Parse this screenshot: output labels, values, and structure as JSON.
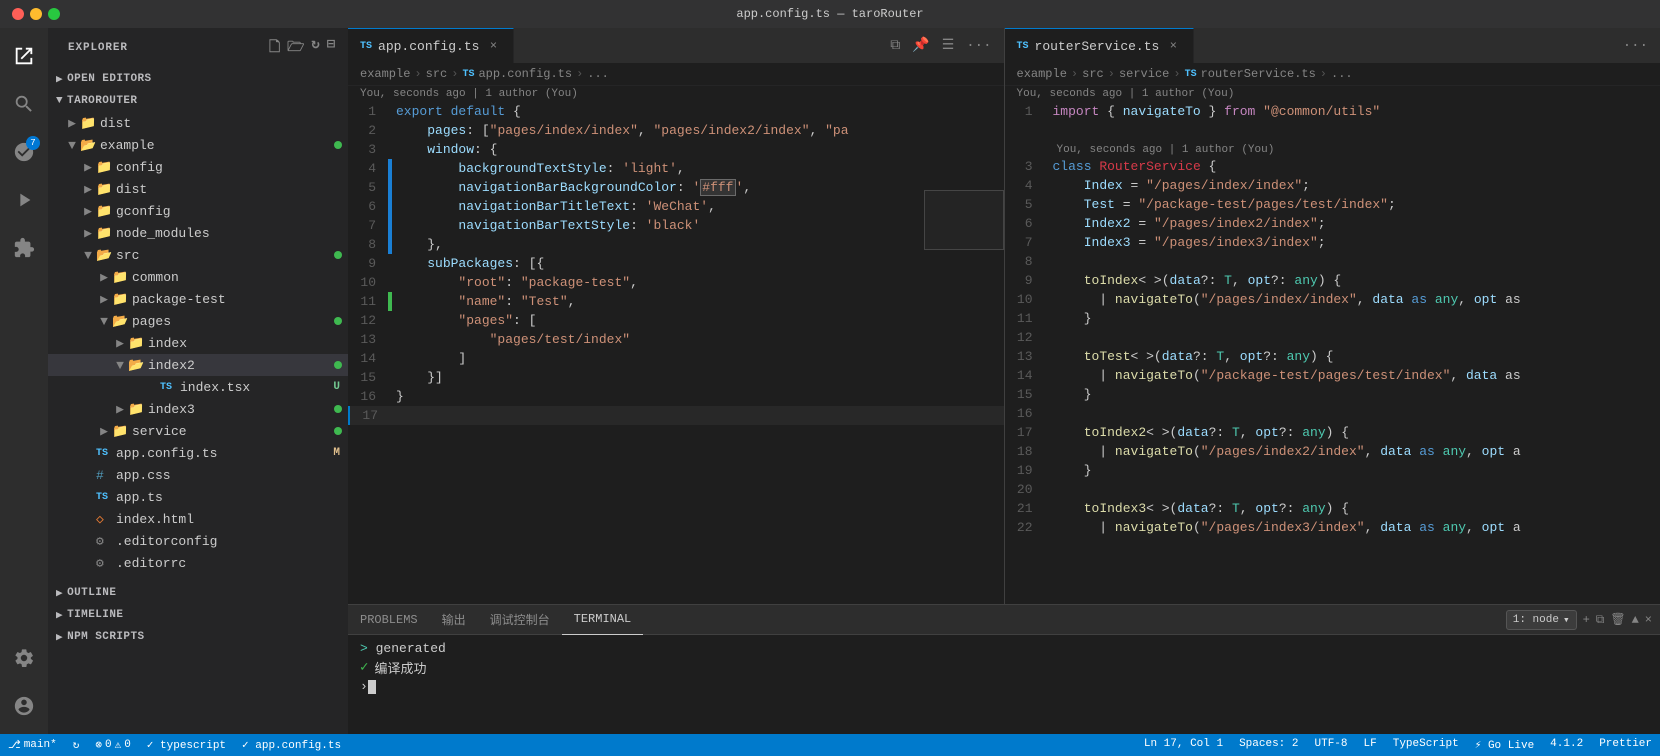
{
  "titlebar": {
    "title": "app.config.ts — taroRouter"
  },
  "sidebar": {
    "title": "EXPLORER",
    "header_actions": [
      "new-file",
      "new-folder",
      "refresh",
      "collapse"
    ],
    "open_editors_label": "OPEN EDITORS",
    "project_label": "TAROROUTER",
    "tree": [
      {
        "id": "dist",
        "label": "dist",
        "type": "folder",
        "depth": 1,
        "expanded": false
      },
      {
        "id": "example",
        "label": "example",
        "type": "folder",
        "depth": 1,
        "expanded": true,
        "dot": "green"
      },
      {
        "id": "config",
        "label": "config",
        "type": "folder",
        "depth": 2,
        "expanded": false
      },
      {
        "id": "dist2",
        "label": "dist",
        "type": "folder",
        "depth": 2,
        "expanded": false
      },
      {
        "id": "gconfig",
        "label": "gconfig",
        "type": "folder",
        "depth": 2,
        "expanded": false
      },
      {
        "id": "node_modules",
        "label": "node_modules",
        "type": "folder",
        "depth": 2,
        "expanded": false
      },
      {
        "id": "src",
        "label": "src",
        "type": "folder",
        "depth": 2,
        "expanded": true,
        "dot": "green"
      },
      {
        "id": "common",
        "label": "common",
        "type": "folder",
        "depth": 3,
        "expanded": false
      },
      {
        "id": "package-test",
        "label": "package-test",
        "type": "folder",
        "depth": 3,
        "expanded": false
      },
      {
        "id": "pages",
        "label": "pages",
        "type": "folder",
        "depth": 3,
        "expanded": true,
        "dot": "green"
      },
      {
        "id": "index",
        "label": "index",
        "type": "folder",
        "depth": 4,
        "expanded": false
      },
      {
        "id": "index2",
        "label": "index2",
        "type": "folder",
        "depth": 4,
        "expanded": true,
        "active": true,
        "dot": "green"
      },
      {
        "id": "index.tsx",
        "label": "index.tsx",
        "type": "ts-file",
        "depth": 5,
        "badge": "U"
      },
      {
        "id": "index3",
        "label": "index3",
        "type": "folder",
        "depth": 4,
        "expanded": false,
        "dot": "green"
      },
      {
        "id": "service",
        "label": "service",
        "type": "folder",
        "depth": 3,
        "expanded": false,
        "dot": "green"
      },
      {
        "id": "app.config.ts",
        "label": "app.config.ts",
        "type": "ts-file",
        "depth": 2,
        "badge": "M"
      },
      {
        "id": "app.css",
        "label": "app.css",
        "type": "css-file",
        "depth": 2
      },
      {
        "id": "app.ts",
        "label": "app.ts",
        "type": "ts-file",
        "depth": 2
      },
      {
        "id": "index.html",
        "label": "index.html",
        "type": "html-file",
        "depth": 2
      },
      {
        "id": ".editorconfig",
        "label": ".editorconfig",
        "type": "config-file",
        "depth": 2
      },
      {
        "id": "editorrc",
        "label": ".editorrc",
        "type": "config-file",
        "depth": 2
      }
    ],
    "outline_label": "OUTLINE",
    "timeline_label": "TIMELINE",
    "npm_scripts_label": "NPM SCRIPTS"
  },
  "left_editor": {
    "tab_label": "app.config.ts",
    "tab_icon": "TS",
    "breadcrumb": [
      "example",
      "src",
      "TS",
      "app.config.ts",
      "..."
    ],
    "git_blame": "You, seconds ago | 1 author (You)",
    "lines": [
      {
        "num": 1,
        "content": "export default {",
        "indicator": ""
      },
      {
        "num": 2,
        "content": "    pages: [\"pages/index/index\", \"pages/index2/index\", \"pa",
        "indicator": ""
      },
      {
        "num": 3,
        "content": "    window: {",
        "indicator": ""
      },
      {
        "num": 4,
        "content": "        backgroundTextStyle: 'light',",
        "indicator": "modified"
      },
      {
        "num": 5,
        "content": "        navigationBarBackgroundColor: '#fff',",
        "indicator": "modified"
      },
      {
        "num": 6,
        "content": "        navigationBarTitleText: 'WeChat',",
        "indicator": "modified"
      },
      {
        "num": 7,
        "content": "        navigationBarTextStyle: 'black'",
        "indicator": "modified"
      },
      {
        "num": 8,
        "content": "    },",
        "indicator": "modified"
      },
      {
        "num": 9,
        "content": "    subPackages: [{",
        "indicator": ""
      },
      {
        "num": 10,
        "content": "        \"root\": \"package-test\",",
        "indicator": ""
      },
      {
        "num": 11,
        "content": "        \"name\": \"Test\",",
        "indicator": "added"
      },
      {
        "num": 12,
        "content": "        \"pages\": [",
        "indicator": ""
      },
      {
        "num": 13,
        "content": "            \"pages/test/index\"",
        "indicator": ""
      },
      {
        "num": 14,
        "content": "        ]",
        "indicator": ""
      },
      {
        "num": 15,
        "content": "    }]",
        "indicator": ""
      },
      {
        "num": 16,
        "content": "}",
        "indicator": ""
      },
      {
        "num": 17,
        "content": "",
        "indicator": ""
      }
    ]
  },
  "right_editor": {
    "tab_label": "routerService.ts",
    "tab_icon": "TS",
    "breadcrumb": [
      "example",
      "src",
      "service",
      "TS",
      "routerService.ts",
      "..."
    ],
    "git_blame": "You, seconds ago | 1 author (You)",
    "git_blame2": "You, seconds ago | 1 author (You)",
    "lines": [
      {
        "num": 1,
        "content": "import { navigateTo } from \"@common/utils\""
      },
      {
        "num": 2,
        "content": ""
      },
      {
        "num": 3,
        "content": "class RouterService {"
      },
      {
        "num": 4,
        "content": "    Index = \"/pages/index/index\";"
      },
      {
        "num": 5,
        "content": "    Test = \"/package-test/pages/test/index\";"
      },
      {
        "num": 6,
        "content": "    Index2 = \"/pages/index2/index\";"
      },
      {
        "num": 7,
        "content": "    Index3 = \"/pages/index3/index\";"
      },
      {
        "num": 8,
        "content": ""
      },
      {
        "num": 9,
        "content": "    toIndex< >(data?: T, opt?: any) {"
      },
      {
        "num": 10,
        "content": "      | navigateTo(\"/pages/index/index\", data as any, opt as"
      },
      {
        "num": 11,
        "content": "    }"
      },
      {
        "num": 12,
        "content": ""
      },
      {
        "num": 13,
        "content": "    toTest< >(data?: T, opt?: any) {"
      },
      {
        "num": 14,
        "content": "      | navigateTo(\"/package-test/pages/test/index\", data as"
      },
      {
        "num": 15,
        "content": "    }"
      },
      {
        "num": 16,
        "content": ""
      },
      {
        "num": 17,
        "content": "    toIndex2< >(data?: T, opt?: any) {"
      },
      {
        "num": 18,
        "content": "      | navigateTo(\"/pages/index2/index\", data as any, opt a"
      },
      {
        "num": 19,
        "content": "    }"
      },
      {
        "num": 20,
        "content": ""
      },
      {
        "num": 21,
        "content": "    toIndex3< >(data?: T, opt?: any) {"
      },
      {
        "num": 22,
        "content": "      | navigateTo(\"/pages/index3/index\", data as any, opt a"
      }
    ]
  },
  "panel": {
    "tabs": [
      "PROBLEMS",
      "输出",
      "调试控制台",
      "TERMINAL"
    ],
    "active_tab": "TERMINAL",
    "terminal_label": "1: node",
    "terminal_content": [
      {
        "type": "prompt",
        "text": "> generated"
      },
      {
        "type": "success",
        "icon": "✓",
        "text": "编译成功"
      }
    ]
  },
  "statusbar": {
    "left": [
      {
        "id": "branch",
        "icon": "⎇",
        "text": "main*"
      },
      {
        "id": "sync",
        "icon": "↻",
        "text": ""
      },
      {
        "id": "errors",
        "icon": "⊗",
        "text": "0"
      },
      {
        "id": "warnings",
        "icon": "⚠",
        "text": "0"
      },
      {
        "id": "typescript",
        "text": "✓ typescript"
      },
      {
        "id": "app_config",
        "text": "✓ app.config.ts"
      }
    ],
    "right": [
      {
        "id": "position",
        "text": "Ln 17, Col 1"
      },
      {
        "id": "spaces",
        "text": "Spaces: 2"
      },
      {
        "id": "encoding",
        "text": "UTF-8"
      },
      {
        "id": "eol",
        "text": "LF"
      },
      {
        "id": "language",
        "text": "TypeScript"
      },
      {
        "id": "golive",
        "text": "⚡ Go Live"
      },
      {
        "id": "version",
        "text": "4.1.2"
      },
      {
        "id": "prettier",
        "text": "Prettier"
      }
    ]
  }
}
